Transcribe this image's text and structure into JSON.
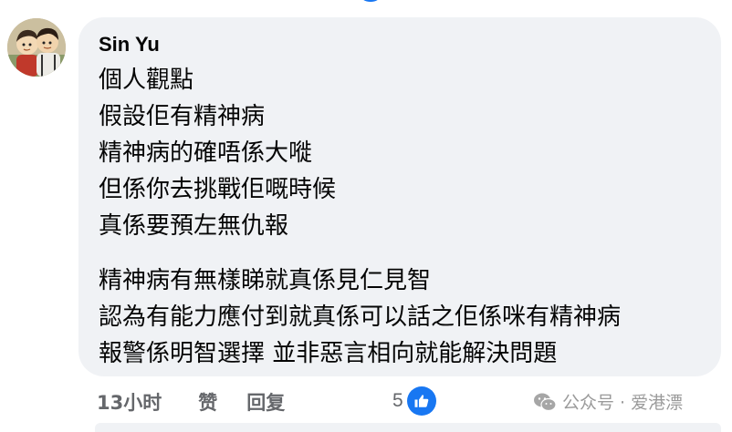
{
  "comment": {
    "author": "Sin Yu",
    "lines": [
      "個人觀點",
      "假設佢有精神病",
      "精神病的確唔係大嘥",
      "但係你去挑戰佢嘅時候",
      "真係要預左無仇報",
      "精神病有無樣睇就真係見仁見智",
      "認為有能力應付到就真係可以話之佢係咪有精神病",
      "報警係明智選擇 並非惡言相向就能解決問題"
    ]
  },
  "actions": {
    "time": "13小时",
    "like_label": "赞",
    "reply_label": "回复"
  },
  "reactions": {
    "count": "5",
    "icon": "thumbs-up-icon",
    "color": "#1877f2"
  },
  "watermark": {
    "text": "公众号 · 爱港漂",
    "icon": "wechat-icon"
  },
  "colors": {
    "bubble_bg": "#f0f2f5",
    "text": "#050505",
    "muted": "#65676b",
    "accent": "#1877f2"
  }
}
